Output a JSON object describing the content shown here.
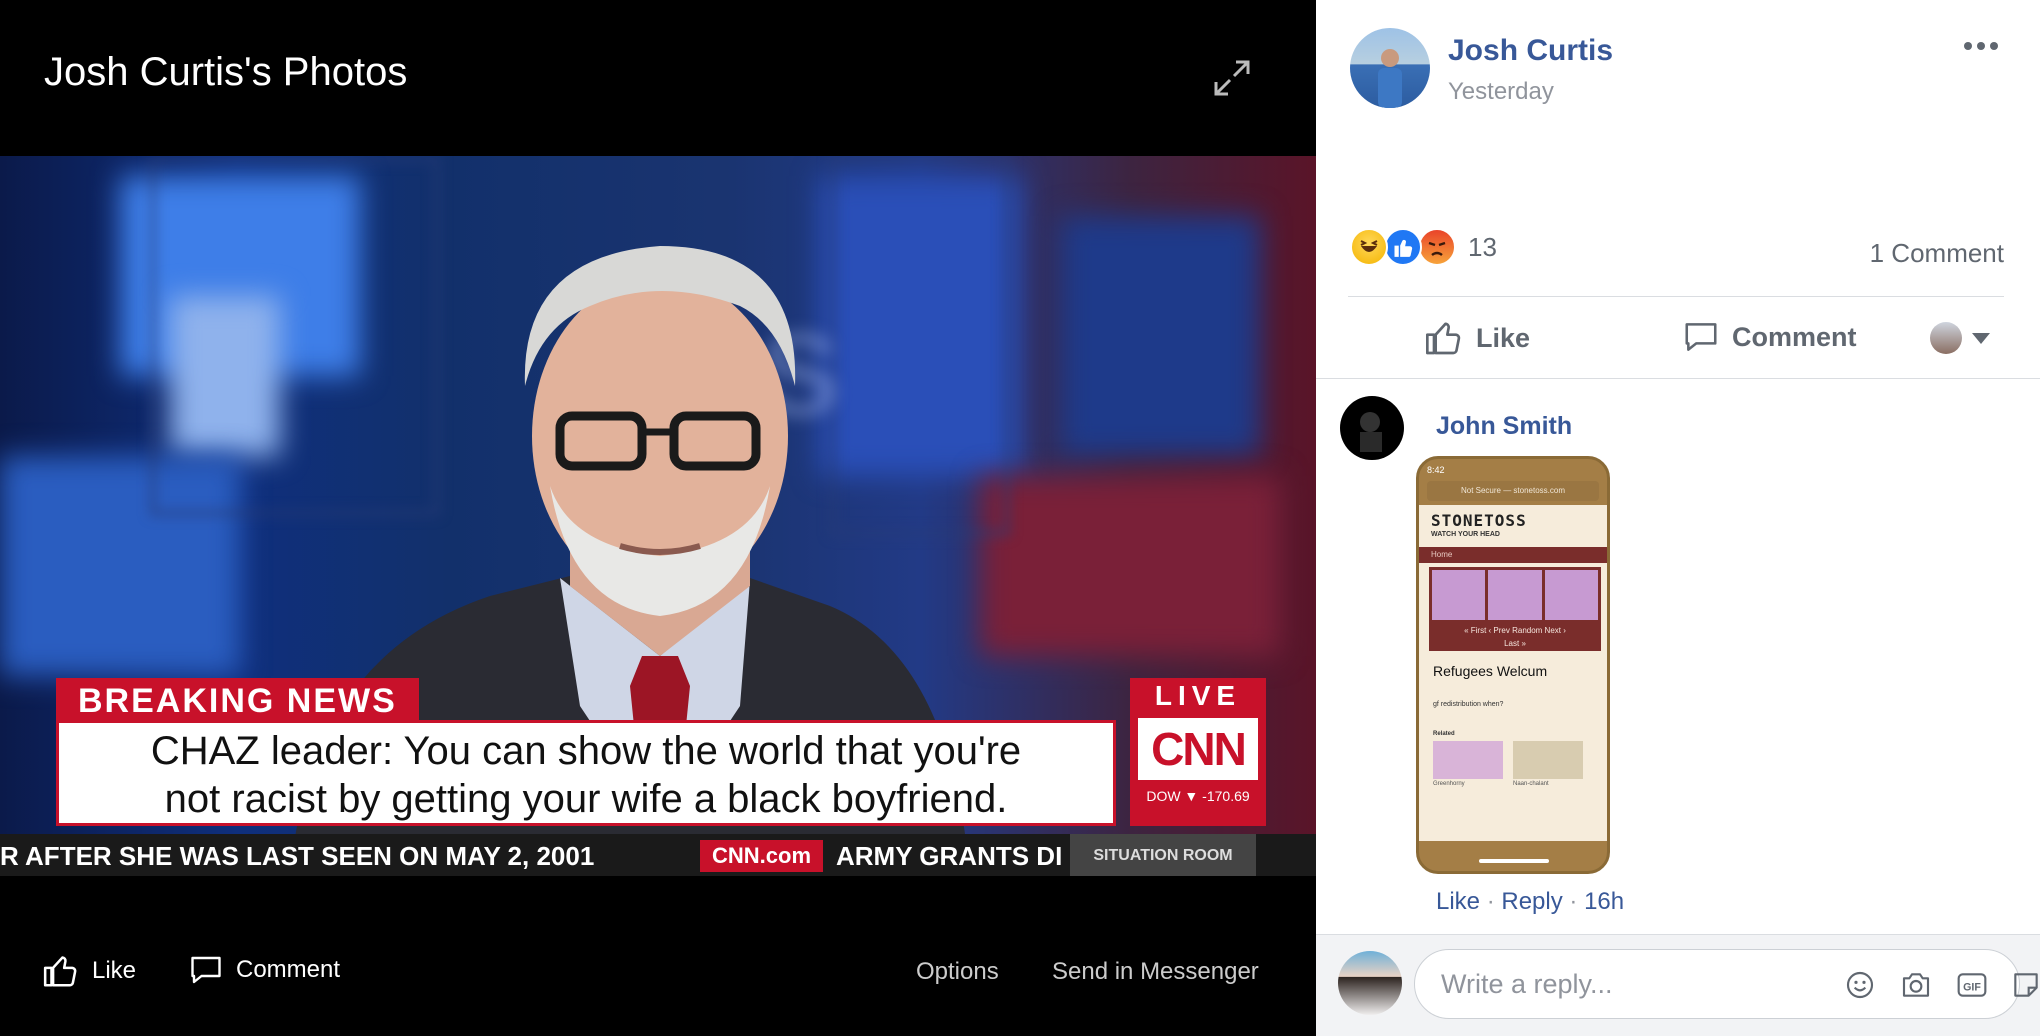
{
  "viewer": {
    "title": "Josh Curtis's Photos",
    "actions": {
      "like": "Like",
      "comment": "Comment",
      "options": "Options",
      "send_messenger": "Send in Messenger"
    }
  },
  "photo": {
    "breaking": "BREAKING NEWS",
    "headline_line1": "CHAZ leader: You can show the world that you're",
    "headline_line2": "not racist by getting your wife a black boyfriend.",
    "live": "LIVE",
    "network": "CNN",
    "dow": "DOW ▼ -170.69",
    "ticker_left": "R AFTER SHE WAS LAST SEEN ON MAY 2, 2001",
    "ticker_site": "CNN.com",
    "ticker_right": "ARMY GRANTS DI",
    "show": "SITUATION ROOM"
  },
  "post": {
    "author": "Josh Curtis",
    "time": "Yesterday",
    "reaction_count": "13",
    "comment_count": "1 Comment",
    "actions": {
      "like": "Like",
      "comment": "Comment"
    }
  },
  "comment": {
    "author": "John Smith",
    "meta_like": "Like",
    "meta_reply": "Reply",
    "meta_time": "16h",
    "screenshot": {
      "time": "8:42",
      "url": "Not Secure — stonetoss.com",
      "site_title": "STONETOSS",
      "site_tagline": "WATCH YOUR HEAD",
      "nav": "Home",
      "pager": "« First  ‹ Prev   Random   Next ›",
      "pager_last": "Last »",
      "post_title": "Refugees Welcum",
      "post_text": "gf redistribution when?",
      "related": "Related",
      "rel1": "Greenhorny",
      "rel2": "Naan-chalant"
    }
  },
  "reply": {
    "placeholder": "Write a reply..."
  }
}
